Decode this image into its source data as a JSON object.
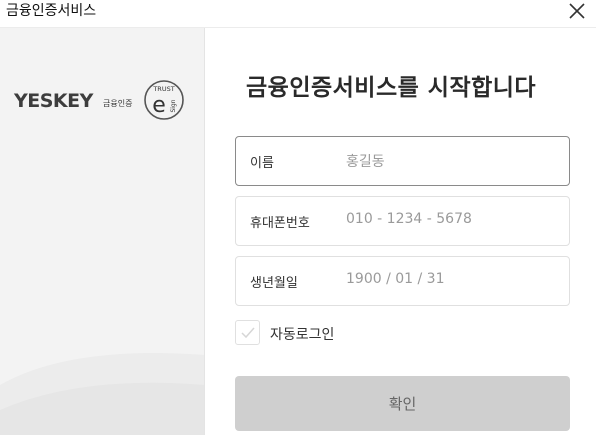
{
  "window": {
    "title": "금융인증서비스"
  },
  "logo": {
    "brand": "YESKEY",
    "sub": "금융인증",
    "seal_top": "TRUST",
    "seal_letter": "e",
    "seal_side": "Sign"
  },
  "heading": "금융인증서비스를 시작합니다",
  "form": {
    "fields": [
      {
        "label": "이름",
        "placeholder": "홍길동"
      },
      {
        "label": "휴대폰번호",
        "placeholder": "010 - 1234 - 5678"
      },
      {
        "label": "생년월일",
        "placeholder": "1900 / 01 / 31"
      }
    ],
    "auto_login": {
      "label": "자동로그인",
      "checked": false
    },
    "confirm_label": "확인"
  },
  "colors": {
    "button_bg": "#cfcfcf",
    "left_panel_bg": "#f3f3f3"
  }
}
